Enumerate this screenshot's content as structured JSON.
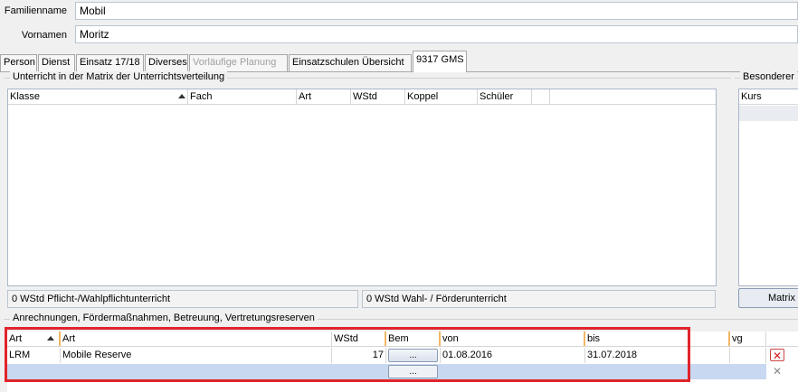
{
  "person": {
    "familienname_label": "Familienname",
    "familienname_value": "Mobil",
    "vornamen_label": "Vornamen",
    "vornamen_value": "Moritz"
  },
  "tabs": [
    {
      "label": "Person",
      "state": "normal"
    },
    {
      "label": "Dienst",
      "state": "normal"
    },
    {
      "label": "Einsatz 17/18",
      "state": "normal"
    },
    {
      "label": "Diverses",
      "state": "normal"
    },
    {
      "label": "Vorläufige Planung",
      "state": "disabled"
    },
    {
      "label": "Einsatzschulen Übersicht",
      "state": "normal"
    },
    {
      "label": "9317 GMS",
      "state": "active"
    }
  ],
  "unterricht": {
    "title": "Unterricht in der Matrix der Unterrichtsverteilung",
    "columns": [
      "Klasse",
      "Fach",
      "Art",
      "WStd",
      "Koppel",
      "Schüler"
    ],
    "rows": [],
    "summary_pflicht": "0 WStd Pflicht-/Wahlpflichtunterricht",
    "summary_wahl": "0 WStd Wahl- / Förderunterricht"
  },
  "besonderer": {
    "title": "Besonderer",
    "columns": [
      "Kurs"
    ],
    "matrix_button": "Matrix"
  },
  "anrechnungen": {
    "title": "Anrechnungen, Fördermaßnahmen, Betreuung, Vertretungsreserven",
    "columns": [
      "Art",
      "Art",
      "WStd",
      "Bem",
      "von",
      "bis",
      "vg"
    ],
    "rows": [
      {
        "art_code": "LRM",
        "art_text": "Mobile Reserve",
        "wstd": "17",
        "bem": "...",
        "von": "01.08.2016",
        "bis": "31.07.2018",
        "vg": ""
      }
    ],
    "new_row_bem": "..."
  },
  "colors": {
    "highlight": "#e0242b",
    "new_row": "#c8d8f0",
    "column_accent": "#f2b664"
  },
  "icons": {
    "delete": "red-x-delete-icon",
    "delete_disabled": "gray-x-delete-icon",
    "sort": "sort-ascending-arrow-icon"
  }
}
